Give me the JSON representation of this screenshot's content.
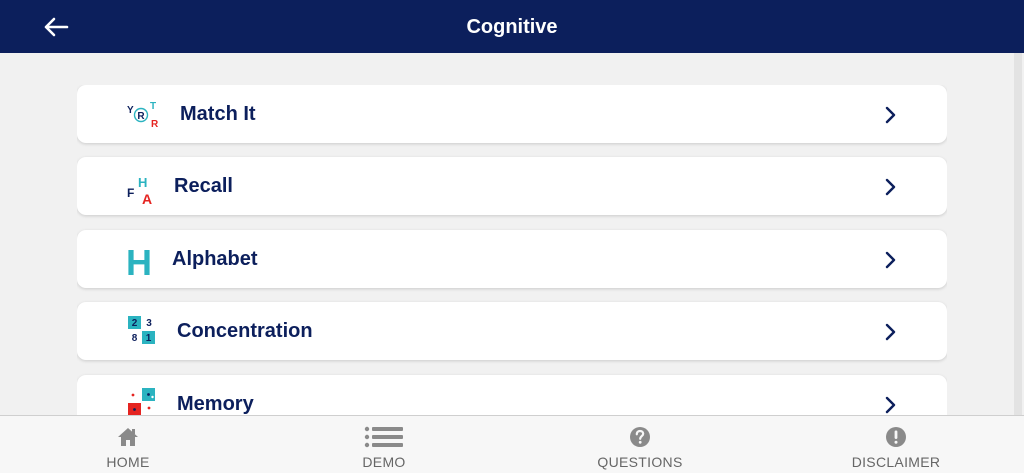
{
  "header": {
    "title": "Cognitive",
    "back_icon": "arrow-left-icon"
  },
  "colors": {
    "navy": "#0c1f5c",
    "teal": "#2bb3c0",
    "red": "#e52421",
    "background": "#f1f1f1"
  },
  "items": [
    {
      "label": "Match It",
      "icon": "match-it-icon",
      "icon_text": [
        "Y",
        "R",
        "T",
        "R"
      ]
    },
    {
      "label": "Recall",
      "icon": "recall-icon",
      "icon_text": [
        "F",
        "H",
        "A"
      ]
    },
    {
      "label": "Alphabet",
      "icon": "alphabet-icon",
      "icon_text": [
        "H"
      ]
    },
    {
      "label": "Concentration",
      "icon": "concentration-icon",
      "icon_text": [
        "2",
        "3",
        "8",
        "1"
      ]
    },
    {
      "label": "Memory",
      "icon": "memory-icon",
      "icon_text": []
    }
  ],
  "tabs": [
    {
      "label": "HOME",
      "icon": "home-icon"
    },
    {
      "label": "DEMO",
      "icon": "list-icon"
    },
    {
      "label": "QUESTIONS",
      "icon": "question-icon"
    },
    {
      "label": "DISCLAIMER",
      "icon": "exclamation-icon"
    }
  ]
}
